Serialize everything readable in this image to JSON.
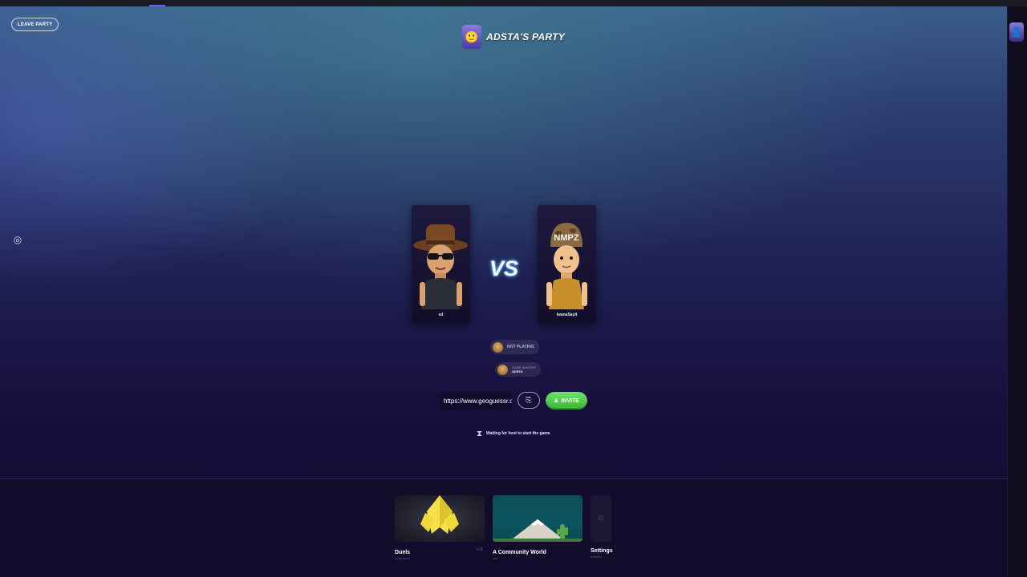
{
  "party": {
    "title": "ADSTA'S PARTY",
    "leave_label": "LEAVE PARTY"
  },
  "players": [
    {
      "name": "ed"
    },
    {
      "name": "IwanaSayIt"
    }
  ],
  "vs_label": "VS",
  "status": {
    "not_playing_label": "NOT PLAYING",
    "game_master_label": "GAME MASTER",
    "game_master_name": "ADSTA"
  },
  "invite": {
    "link_value": "https://www.geoguessr.com/",
    "invite_label": "INVITE"
  },
  "waiting_text": "Waiting for host to start the game",
  "games": [
    {
      "label": "Duels",
      "sub": "GAME MODE",
      "icon": "duels-shield-icon"
    },
    {
      "label": "A Community World",
      "sub": "MAP",
      "icon": "mountain-icon"
    },
    {
      "label": "Settings",
      "sub": "OPTIONS",
      "icon": "gear-icon"
    }
  ],
  "players_count": "2",
  "colors": {
    "invite_green": "#4cc849",
    "vs_glow": "#4fb0ff",
    "background_dark": "#130a30"
  }
}
